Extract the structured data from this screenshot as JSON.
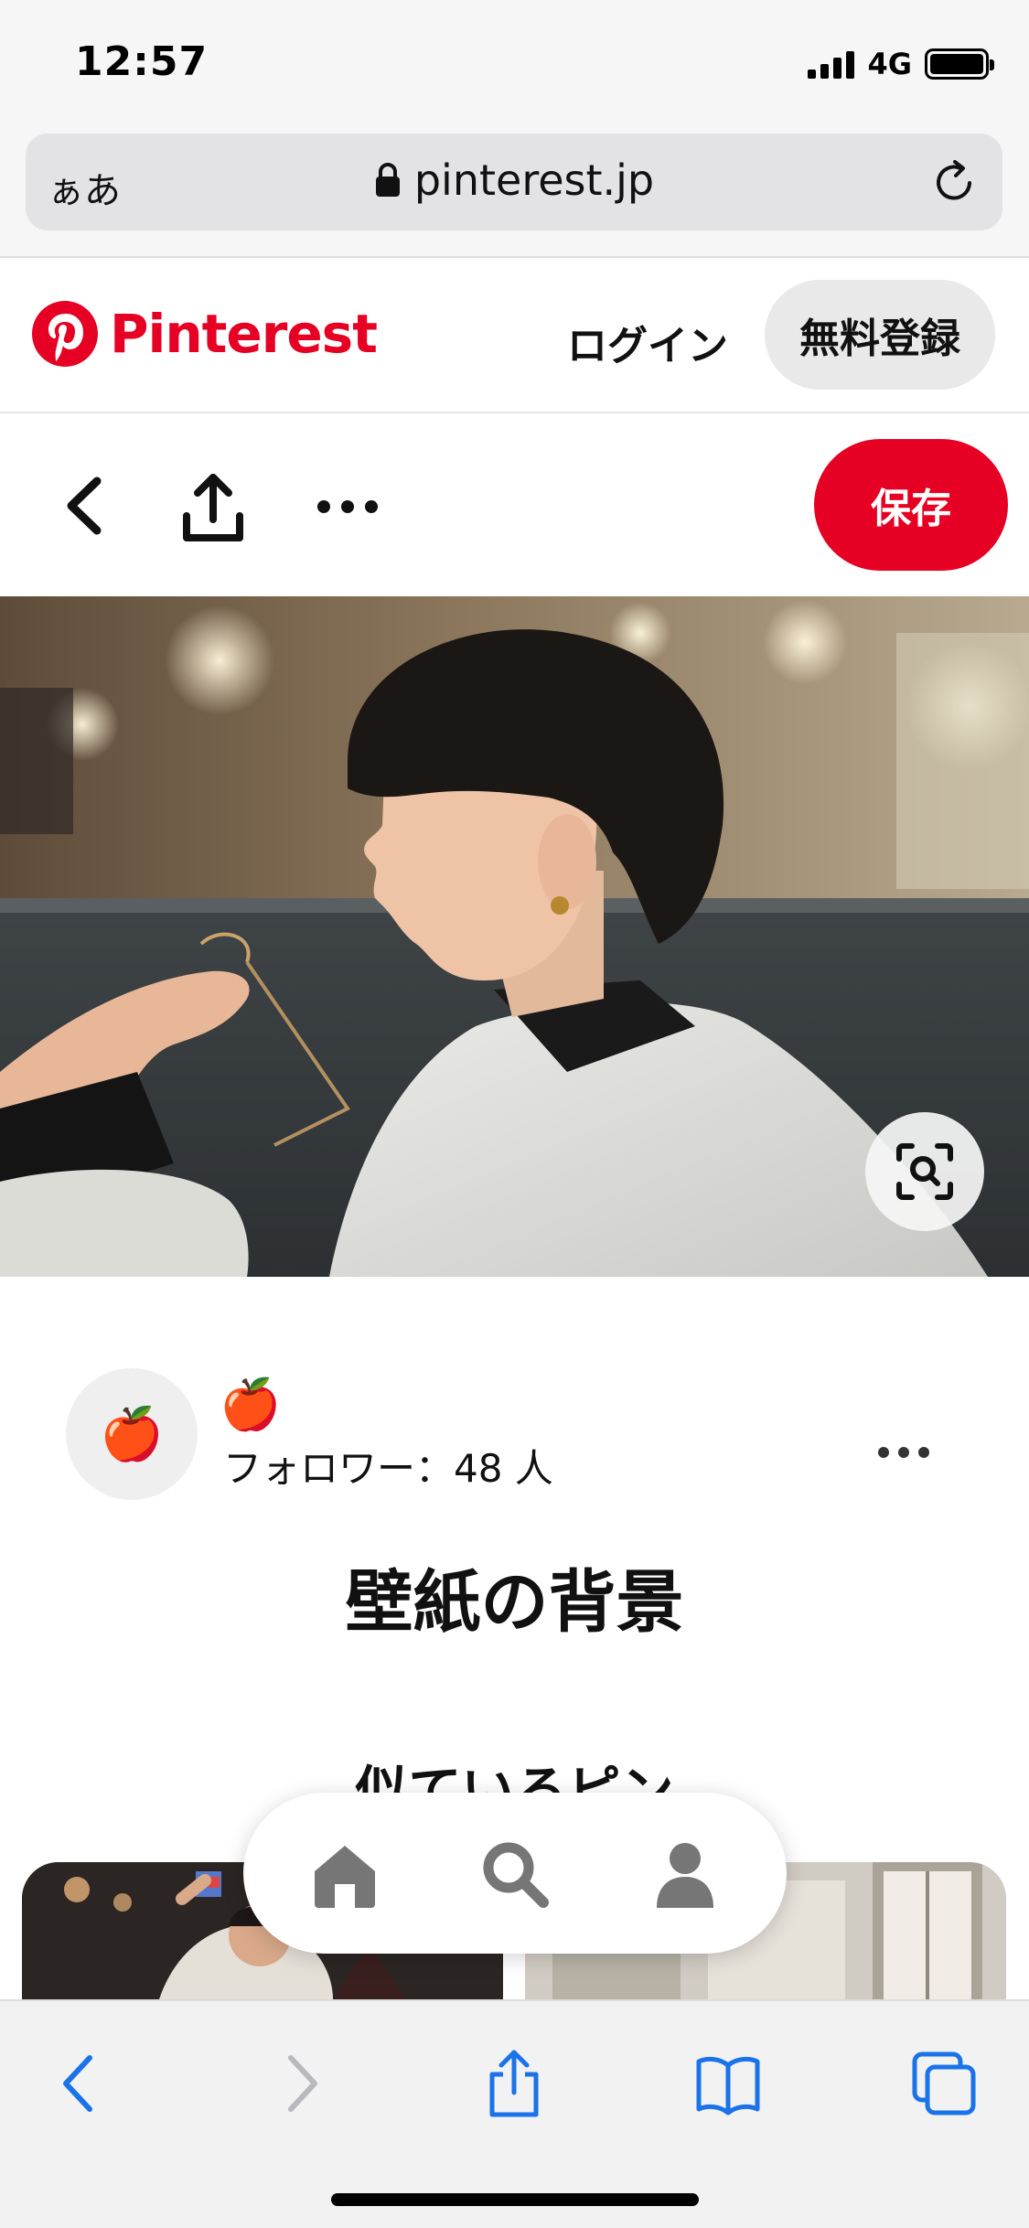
{
  "status_bar": {
    "time": "12:57",
    "network": "4G"
  },
  "browser": {
    "text_size_label": "ぁあ",
    "url": "pinterest.jp"
  },
  "header": {
    "brand": "Pinterest",
    "login_label": "ログイン",
    "signup_label": "無料登録"
  },
  "actions": {
    "save_label": "保存"
  },
  "creator": {
    "avatar_emoji": "🍎",
    "name": "🍎",
    "followers": "フォロワー：48 人"
  },
  "pin": {
    "title": "壁紙の背景"
  },
  "similar": {
    "title": "似ているピン"
  },
  "bottom_nav": [
    "home-icon",
    "search-icon",
    "profile-icon"
  ],
  "safari_toolbar": [
    "back-icon",
    "forward-icon",
    "share-icon",
    "bookmarks-icon",
    "tabs-icon"
  ],
  "colors": {
    "brand_red": "#e60023",
    "safari_blue": "#1a73e8",
    "disabled_gray": "#b8b8bd"
  }
}
